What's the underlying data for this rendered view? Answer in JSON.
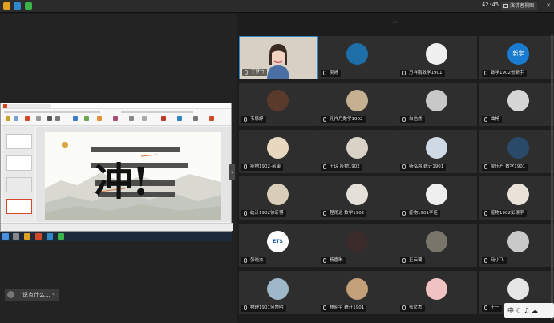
{
  "topbar": {
    "clock": "42:45",
    "present_label": "演讲者视图",
    "minimize_label": "—",
    "close_label": "✕",
    "icon_colors": [
      "#2f88c9",
      "#7f6bd6",
      "#3ab54a"
    ]
  },
  "chat": {
    "placeholder": "说点什么..."
  },
  "slide": {
    "big_char": "冲!"
  },
  "tray": {
    "text": "中 ☾ ♫ ☁"
  },
  "tiles": [
    {
      "name": "丁梦竹",
      "kind": "video"
    },
    {
      "name": "吴婷",
      "kind": "avatar",
      "color": "#1e6fa8"
    },
    {
      "name": "万祥鹏数学1901",
      "kind": "avatar",
      "color": "#f0f0f0"
    },
    {
      "name": "数学1902张新宇",
      "kind": "avatar",
      "color": "#1a7cd1",
      "text": "新宇"
    },
    {
      "name": "韦思婷",
      "kind": "avatar",
      "color": "#5a3a2a"
    },
    {
      "name": "孔祥月数学1902",
      "kind": "avatar",
      "color": "#c5b092"
    },
    {
      "name": "白浩然",
      "kind": "avatar",
      "color": "#c8c8c8"
    },
    {
      "name": "曲畅",
      "kind": "avatar",
      "color": "#d6d6d6"
    },
    {
      "name": "疫物1902-余康",
      "kind": "avatar",
      "color": "#e8d8c0"
    },
    {
      "name": "王琼 疫物1902",
      "kind": "avatar",
      "color": "#d9d3c7"
    },
    {
      "name": "杨泓恩 统计1901",
      "kind": "avatar",
      "color": "#cfd9e6"
    },
    {
      "name": "吴乐丹 数学1901",
      "kind": "avatar",
      "color": "#2a4a6a"
    },
    {
      "name": "统计1902徐昕博",
      "kind": "avatar",
      "color": "#d8cdb8"
    },
    {
      "name": "程雨远 数学1902",
      "kind": "avatar",
      "color": "#e4e0d8"
    },
    {
      "name": "疫物1901李佳",
      "kind": "avatar",
      "color": "#efefef"
    },
    {
      "name": "疫物1902彭璟宇",
      "kind": "avatar",
      "color": "#e9e2d8"
    },
    {
      "name": "张晓杰",
      "kind": "avatar",
      "color": "#ffffff",
      "text": "ETS"
    },
    {
      "name": "杨嘉琳",
      "kind": "avatar",
      "color": "#3b2b2b"
    },
    {
      "name": "王云鹭",
      "kind": "avatar",
      "color": "#7a756a"
    },
    {
      "name": "马小飞",
      "kind": "avatar",
      "color": "#c9c9c9"
    },
    {
      "name": "物理1901何崇明",
      "kind": "avatar",
      "color": "#9fb8c9"
    },
    {
      "name": "林昭宇 统计1901",
      "kind": "avatar",
      "color": "#c4a07a"
    },
    {
      "name": "张文杰",
      "kind": "avatar",
      "color": "#f1c2c2"
    },
    {
      "name": "王一",
      "kind": "avatar",
      "color": "#e6e6e6"
    }
  ]
}
